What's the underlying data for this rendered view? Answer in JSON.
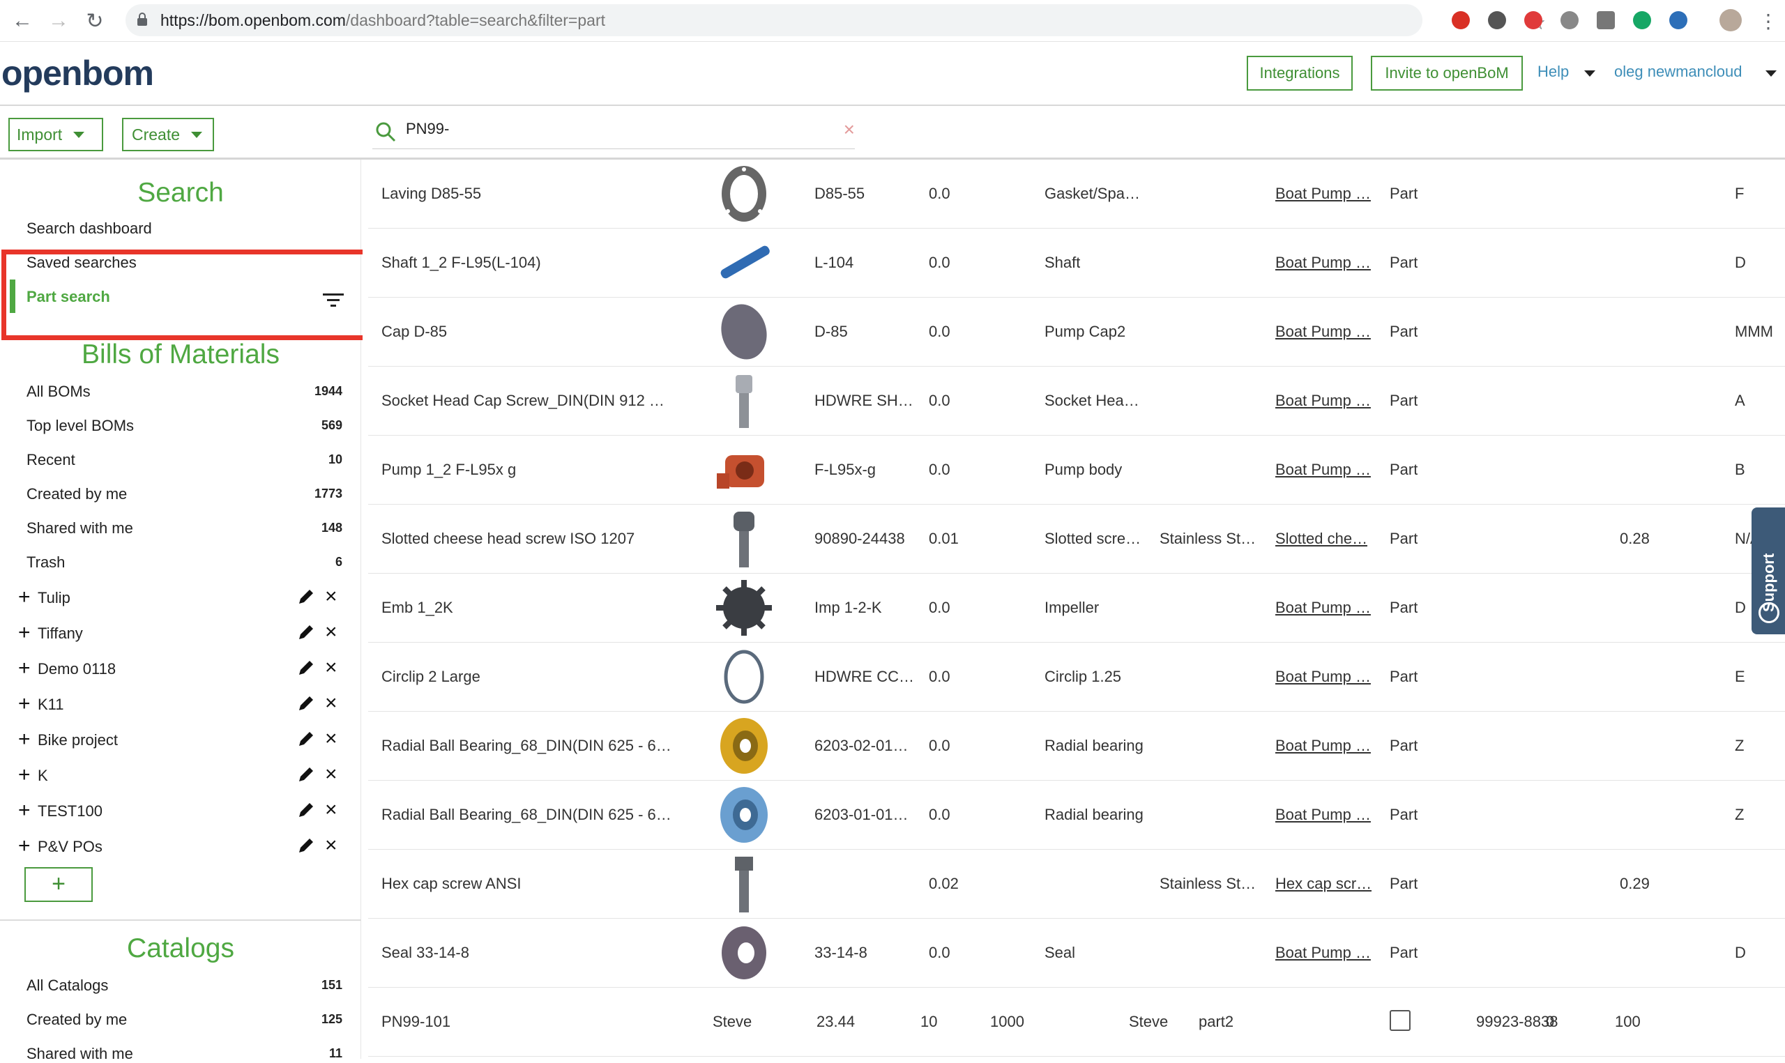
{
  "browser": {
    "url_host": "https://bom.openbom.com",
    "url_path": "/dashboard?table=search&filter=part"
  },
  "header": {
    "logo": "openbom",
    "integrations": "Integrations",
    "invite": "Invite to openBoM",
    "help": "Help",
    "user": "oleg newmancloud"
  },
  "toolbar": {
    "import": "Import",
    "create": "Create",
    "search_value": "PN99-"
  },
  "sidebar": {
    "search_title": "Search",
    "search_dashboard": "Search dashboard",
    "saved_searches": "Saved searches",
    "part_search": "Part search",
    "boms_title": "Bills of Materials",
    "bom_links": [
      {
        "label": "All BOMs",
        "count": "1944"
      },
      {
        "label": "Top level BOMs",
        "count": "569"
      },
      {
        "label": "Recent",
        "count": "10"
      },
      {
        "label": "Created by me",
        "count": "1773"
      },
      {
        "label": "Shared with me",
        "count": "148"
      },
      {
        "label": "Trash",
        "count": "6"
      }
    ],
    "folders": [
      "Tulip",
      "Tiffany",
      "Demo 0118",
      "K11",
      "Bike project",
      "K",
      "TEST100",
      "P&V POs"
    ],
    "add_label": "+",
    "catalogs_title": "Catalogs",
    "catalog_links": [
      {
        "label": "All Catalogs",
        "count": "151"
      },
      {
        "label": "Created by me",
        "count": "125"
      },
      {
        "label": "Shared with me",
        "count": "11"
      }
    ]
  },
  "rows": [
    {
      "name": "Laving D85-55",
      "part": "D85-55",
      "qty": "0.0",
      "desc": "Gasket/Spa…",
      "material": "",
      "bom": "Boat Pump …",
      "type": "Part",
      "cost": "",
      "rev": "F",
      "icon": "gasket-ring"
    },
    {
      "name": "Shaft 1_2 F-L95(L-104)",
      "part": "L-104",
      "qty": "0.0",
      "desc": "Shaft",
      "material": "",
      "bom": "Boat Pump …",
      "type": "Part",
      "cost": "",
      "rev": "D",
      "icon": "shaft"
    },
    {
      "name": "Cap D-85",
      "part": "D-85",
      "qty": "0.0",
      "desc": "Pump Cap2",
      "material": "",
      "bom": "Boat Pump …",
      "type": "Part",
      "cost": "",
      "rev": "MMM",
      "icon": "cap-disc"
    },
    {
      "name": "Socket Head Cap Screw_DIN(DIN 912 …",
      "part": "HDWRE SH…",
      "qty": "0.0",
      "desc": "Socket Hea…",
      "material": "",
      "bom": "Boat Pump …",
      "type": "Part",
      "cost": "",
      "rev": "A",
      "icon": "socket-screw"
    },
    {
      "name": "Pump 1_2 F-L95x g",
      "part": "F-L95x-g",
      "qty": "0.0",
      "desc": "Pump body",
      "material": "",
      "bom": "Boat Pump …",
      "type": "Part",
      "cost": "",
      "rev": "B",
      "icon": "pump-body"
    },
    {
      "name": "Slotted cheese head screw ISO 1207",
      "part": "90890-24438",
      "qty": "0.01",
      "desc": "Slotted scre…",
      "material": "Stainless St…",
      "bom": "Slotted che…",
      "type": "Part",
      "cost": "0.28",
      "rev": "N/A",
      "icon": "cheese-screw"
    },
    {
      "name": "Emb 1_2K",
      "part": "Imp 1-2-K",
      "qty": "0.0",
      "desc": "Impeller",
      "material": "",
      "bom": "Boat Pump …",
      "type": "Part",
      "cost": "",
      "rev": "D",
      "icon": "impeller"
    },
    {
      "name": "Circlip 2 Large",
      "part": "HDWRE CC…",
      "qty": "0.0",
      "desc": "Circlip 1.25",
      "material": "",
      "bom": "Boat Pump …",
      "type": "Part",
      "cost": "",
      "rev": "E",
      "icon": "circlip"
    },
    {
      "name": "Radial Ball Bearing_68_DIN(DIN 625 - 6…",
      "part": "6203-02-01…",
      "qty": "0.0",
      "desc": "Radial bearing",
      "material": "",
      "bom": "Boat Pump …",
      "type": "Part",
      "cost": "",
      "rev": "Z",
      "icon": "bearing-gold"
    },
    {
      "name": "Radial Ball Bearing_68_DIN(DIN 625 - 6…",
      "part": "6203-01-01…",
      "qty": "0.0",
      "desc": "Radial bearing",
      "material": "",
      "bom": "Boat Pump …",
      "type": "Part",
      "cost": "",
      "rev": "Z",
      "icon": "bearing-blue"
    },
    {
      "name": "Hex cap screw ANSI",
      "part": "",
      "qty": "0.02",
      "desc": "",
      "material": "Stainless St…",
      "bom": "Hex cap scr…",
      "type": "Part",
      "cost": "0.29",
      "rev": "",
      "icon": "hex-screw"
    },
    {
      "name": "Seal 33-14-8",
      "part": "33-14-8",
      "qty": "0.0",
      "desc": "Seal",
      "material": "",
      "bom": "Boat Pump …",
      "type": "Part",
      "cost": "",
      "rev": "D",
      "icon": "seal"
    }
  ],
  "last_row": {
    "name": "PN99-101",
    "thumb_col": "Steve",
    "part": "23.44",
    "qty": "10",
    "desc": "1000",
    "material": "Steve",
    "bom": "part2",
    "extra": "99923-8838",
    "cost": "0",
    "rev": "100"
  },
  "support": "Support",
  "colors": {
    "accent_green": "#4fa842",
    "highlight_red": "#e8352a",
    "support_blue": "#3d5a78"
  }
}
